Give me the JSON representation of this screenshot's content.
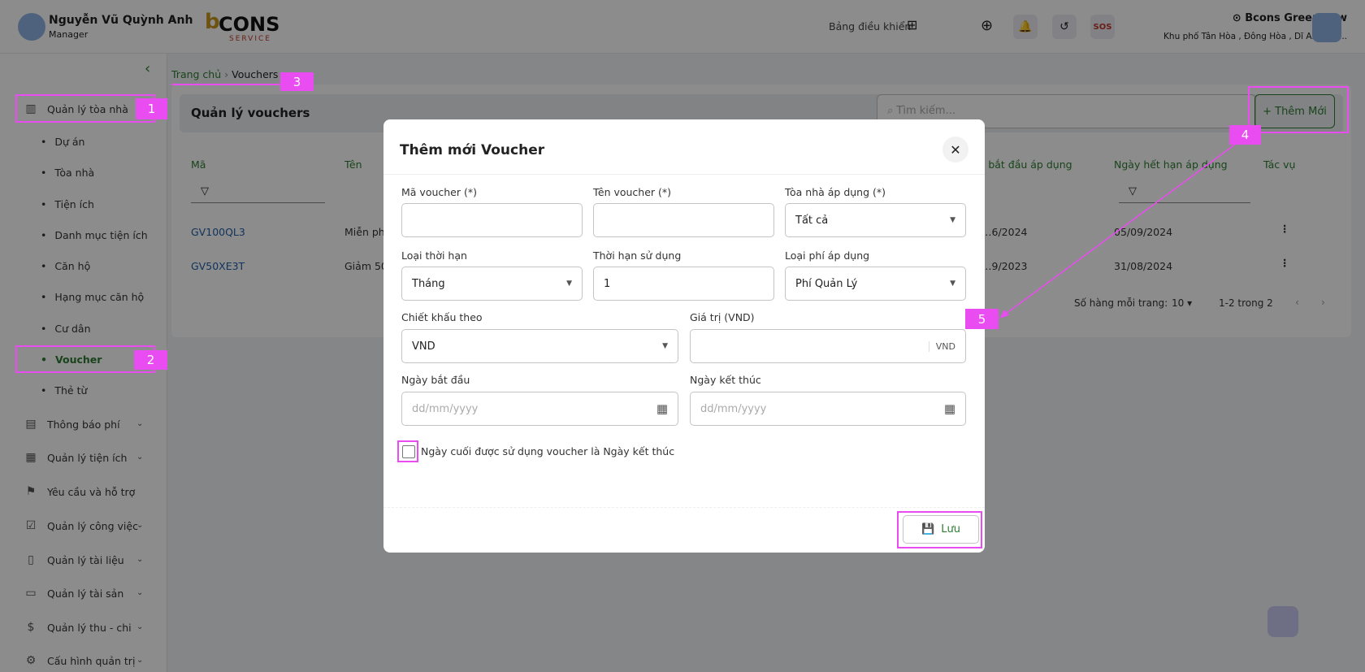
{
  "header": {
    "user_name": "Nguyễn Vũ Quỳnh Anh",
    "user_role": "Manager",
    "logo_text": "CONS",
    "logo_sub": "SERVICE",
    "dashboard_label": "Bảng điều khiển",
    "sos_label": "SOS",
    "building_name": "Bcons Greenview",
    "building_address": "Khu phố Tân Hòa , Đông Hòa , Dĩ An , Bìn..."
  },
  "sidebar": {
    "items": [
      {
        "label": "Quản lý tòa nhà",
        "icon": "building-icon"
      },
      {
        "label": "Thông báo phí",
        "icon": "receipt-icon"
      },
      {
        "label": "Quản lý tiện ích",
        "icon": "layout-icon"
      },
      {
        "label": "Yêu cầu và hỗ trợ",
        "icon": "flag-icon"
      },
      {
        "label": "Quản lý công việc",
        "icon": "task-icon"
      },
      {
        "label": "Quản lý tài liệu",
        "icon": "document-icon"
      },
      {
        "label": "Quản lý tài sản",
        "icon": "archive-icon"
      },
      {
        "label": "Quản lý thu - chi",
        "icon": "dollar-icon"
      },
      {
        "label": "Cấu hình quản trị",
        "icon": "gear-icon"
      }
    ],
    "sub_items": [
      "Dự án",
      "Tòa nhà",
      "Tiện ích",
      "Danh mục tiện ích",
      "Căn hộ",
      "Hạng mục căn hộ",
      "Cư dân",
      "Voucher",
      "Thẻ từ"
    ]
  },
  "breadcrumb": {
    "home": "Trang chủ",
    "current": "Vouchers"
  },
  "page": {
    "title": "Quản lý vouchers",
    "search_placeholder": "Tìm kiếm...",
    "add_button": "Thêm Mới"
  },
  "table": {
    "columns": [
      "Mã",
      "Tên",
      "Ngày bắt đầu áp dụng",
      "Ngày hết hạn áp dụng",
      "Tác vụ"
    ],
    "rows": [
      {
        "code": "GV100QL3",
        "name": "Miễn phí",
        "start": "…6/2024",
        "end": "05/09/2024"
      },
      {
        "code": "GV50XE3T",
        "name": "Giảm 50",
        "start": "…9/2023",
        "end": "31/08/2024"
      }
    ],
    "rows_per_page_label": "Số hàng mỗi trang:",
    "rows_per_page": "10",
    "range": "1-2 trong 2"
  },
  "modal": {
    "title": "Thêm mới Voucher",
    "fields": {
      "code_label": "Mã voucher (*)",
      "name_label": "Tên voucher (*)",
      "building_label": "Tòa nhà áp dụng (*)",
      "building_value": "Tất cả",
      "period_type_label": "Loại thời hạn",
      "period_type_value": "Tháng",
      "duration_label": "Thời hạn sử dụng",
      "duration_value": "1",
      "fee_type_label": "Loại phí áp dụng",
      "fee_type_value": "Phí Quản Lý",
      "discount_by_label": "Chiết khấu theo",
      "discount_by_value": "VND",
      "value_label": "Giá trị (VND)",
      "value_unit": "VND",
      "start_label": "Ngày bắt đầu",
      "start_placeholder": "dd/mm/yyyy",
      "end_label": "Ngày kết thúc",
      "end_placeholder": "dd/mm/yyyy"
    },
    "checkbox_label": "Ngày cuối được sử dụng voucher là Ngày kết thúc",
    "checkbox_checked": false,
    "save_button": "Lưu"
  },
  "annotations": [
    "1",
    "2",
    "3",
    "4",
    "5"
  ],
  "colors": {
    "accent": "#2e7d32",
    "link": "#1f5fa8",
    "annotation": "#e94cf0"
  }
}
